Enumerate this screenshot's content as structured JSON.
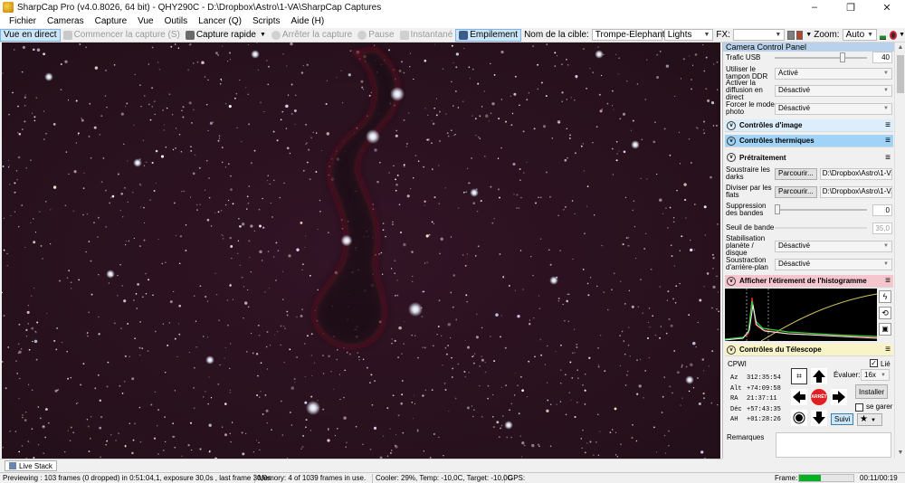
{
  "window": {
    "title": "SharpCap Pro (v4.0.8026, 64 bit) - QHY290C - D:\\Dropbox\\Astro\\1-VA\\SharpCap Captures",
    "minimize": "–",
    "maximize": "❐",
    "close": "✕"
  },
  "menu": [
    "Fichier",
    "Cameras",
    "Capture",
    "Vue",
    "Outils",
    "Lancer (Q)",
    "Scripts",
    "Aide (H)"
  ],
  "toolbar": {
    "live": "Vue en direct",
    "start_capture": "Commencer la capture (S)",
    "quick_capture": "Capture rapide",
    "stop_capture": "Arrêter la capture",
    "pause": "Pause",
    "snapshot": "Instantané",
    "stacking": "Empilement",
    "target_label": "Nom de la cible:",
    "target_value": "Trompe-Elephant",
    "frame_type": "Lights",
    "fx_label": "FX:",
    "fx_value": "",
    "zoom_label": "Zoom:",
    "zoom_value": "Auto"
  },
  "panel": {
    "title": "Camera Control Panel",
    "usb": {
      "label": "Trafic USB",
      "value": "40"
    },
    "ddr": {
      "label": "Utiliser le tampon DDR",
      "value": "Activé"
    },
    "live_diffusion": {
      "label": "Activer la diffusion en direct",
      "value": "Désactivé"
    },
    "photo_mode": {
      "label": "Forcer le mode photo",
      "value": "Désactivé"
    },
    "sections": {
      "image": "Contrôles d'image",
      "thermal": "Contrôles thermiques",
      "preprocessing": "Prétraitement",
      "histogram": "Afficher l'étirement de l'histogramme",
      "telescope": "Contrôles du Télescope"
    },
    "darks": {
      "label": "Soustraire les darks",
      "button": "Parcourir...",
      "path": "D:\\Dropbox\\Astro\\1-V..."
    },
    "flats": {
      "label": "Diviser par les flats",
      "button": "Parcourir...",
      "path": "D:\\Dropbox\\Astro\\1-V..."
    },
    "banding": {
      "label": "Suppression des bandes",
      "value": "0"
    },
    "band_threshold": {
      "label": "Seuil de bande",
      "value": "35,0"
    },
    "stabilization": {
      "label": "Stabilisation planète / disque",
      "value": "Désactivé"
    },
    "background": {
      "label": "Soustraction d'arrière-plan",
      "value": "Désactivé"
    },
    "telescope": {
      "name": "CPWI",
      "linked_label": "Lié",
      "linked": true,
      "evaluate_label": "Évaluer:",
      "rate": "16x",
      "install": "Installer",
      "park_label": "se garer",
      "track": "Suivi",
      "stop": "ARRÊT",
      "coords": [
        {
          "key": "Az",
          "value": "312:35:54"
        },
        {
          "key": "Alt",
          "value": "+74:09:58"
        },
        {
          "key": "RA",
          "value": "21:37:11"
        },
        {
          "key": "Déc",
          "value": "+57:43:35"
        },
        {
          "key": "AH",
          "value": "+01:28:26"
        }
      ]
    },
    "remarks_label": "Remarques"
  },
  "tabs": {
    "live_stack": "Live Stack"
  },
  "status": {
    "previewing": "Previewing : 103 frames (0 dropped) in 0:51:04,1, exposure 30,0s , last frame 30,0s",
    "memory": "Memory: 4 of 1039 frames in use.",
    "cooler": "Cooler: 29%, Temp: -10,0C, Target: -10,0C",
    "gps": "GPS:",
    "frame_label": "Frame:",
    "time": "00:11/00:19",
    "frame_progress": 0.4
  },
  "colors": {
    "sky": "#2a1020",
    "nebula_edge": "#a01a2e",
    "accent_blue": "#cde6f7",
    "progress_green": "#06b025"
  }
}
